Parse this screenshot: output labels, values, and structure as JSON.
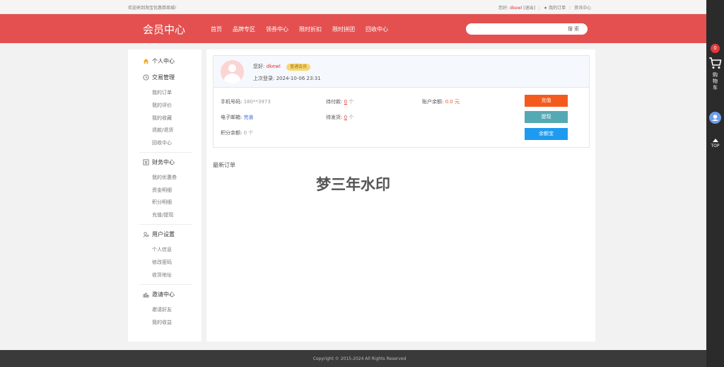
{
  "topbar": {
    "welcome": "欢迎来到淘宝优惠券商城!",
    "greeting": "您好:",
    "username": "dkewl",
    "logout": "[退出]",
    "my_orders": "★ 我的订单",
    "news": "资讯中心"
  },
  "header": {
    "logo": "会员中心",
    "nav": [
      "首页",
      "品牌专区",
      "领券中心",
      "限时折扣",
      "限时拼团",
      "回收中心"
    ],
    "search_placeholder": "",
    "search_button": "搜 索"
  },
  "sidebar": {
    "sections": [
      {
        "title": "个人中心",
        "icon": "home-icon",
        "items": []
      },
      {
        "title": "交易管理",
        "icon": "clock-icon",
        "items": [
          "我的订单",
          "我的评价",
          "我的收藏",
          "退款/退货",
          "回收中心"
        ]
      },
      {
        "title": "财务中心",
        "icon": "wallet-icon",
        "items": [
          "我的优惠券",
          "资金明细",
          "积分明细",
          "充值/提现"
        ]
      },
      {
        "title": "用户设置",
        "icon": "user-settings-icon",
        "items": [
          "个人信息",
          "修改密码",
          "收货地址"
        ]
      },
      {
        "title": "邀请中心",
        "icon": "invite-icon",
        "items": [
          "邀请好友",
          "我的收益"
        ]
      }
    ]
  },
  "profile": {
    "greeting": "您好:",
    "username": "dkewl",
    "level": "普通会员",
    "last_login_label": "上次登录:",
    "last_login": "2024-10-06 23:31"
  },
  "account": {
    "phone_label": "手机号码:",
    "phone": "180**3973",
    "email_label": "电子邮箱:",
    "email_action": "完善",
    "points_label": "积分余额:",
    "points": "0 个",
    "pending_pay_label": "待付款:",
    "pending_pay_count": "0",
    "pending_pay_unit": "个",
    "pending_ship_label": "待发货:",
    "pending_ship_count": "0",
    "pending_ship_unit": "个",
    "balance_label": "账户余额:",
    "balance": "0.0 元",
    "recharge_button": "充值",
    "withdraw_button": "提现",
    "yuebao_button": "余额宝"
  },
  "orders": {
    "title": "最新订单",
    "watermark": "梦三年水印"
  },
  "footer": {
    "copyright": "Copyright © 2015-2024 All Rights Reserved"
  },
  "rightbar": {
    "cart_count": "0",
    "cart_label": "购物车",
    "top_label": "TOP"
  },
  "colors": {
    "brand_red": "#e45050",
    "recharge": "#f55a1d",
    "withdraw": "#55a9b3",
    "yuebao": "#1e9bf0"
  }
}
